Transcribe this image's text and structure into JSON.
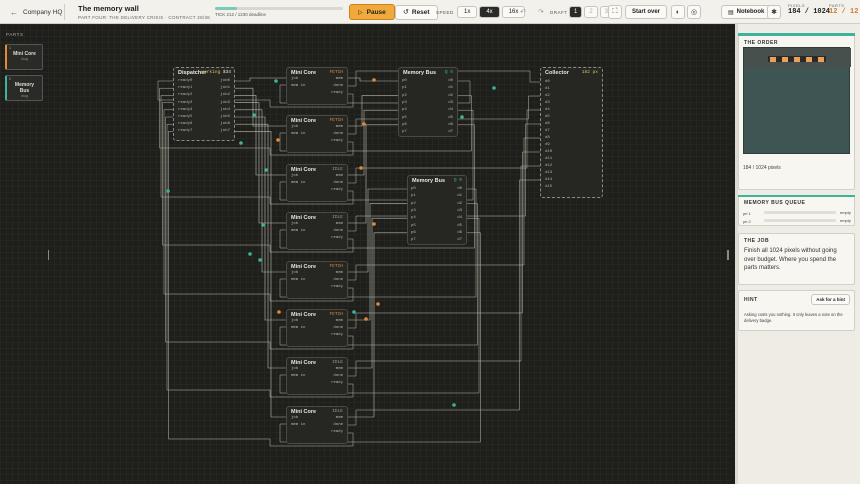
{
  "topbar": {
    "back_label": "Company HQ",
    "title": "The memory wall",
    "subtitle": "PART FOUR: THE DELIVERY CRISIS · CONTRACT 28/36",
    "tick_text": "TICK 212 / 1230 deadline",
    "tick_progress": 0.17,
    "pause_label": "Pause",
    "reset_label": "Reset",
    "speed_label": "SPEED",
    "speeds": [
      "1x",
      "4x",
      "16x"
    ],
    "draft_label": "DRAFT",
    "drafts": [
      "1",
      "2",
      "3"
    ],
    "start_over_label": "Start over",
    "notebook_label": "Notebook",
    "pixels_label": "PIXELS",
    "pixels_value": "184 / 1024",
    "parts_label": "PARTS",
    "parts_value": "12 / 12"
  },
  "parts_panel": {
    "title": "PARTS",
    "items": [
      {
        "count": "1",
        "name": "Mini Core",
        "action": "drag",
        "color": "#e08a3c"
      },
      {
        "count": "2",
        "name": "Memory Bus",
        "action": "drag",
        "color": "#3cb39a"
      }
    ]
  },
  "nodes": {
    "dispatcher": {
      "title": "Dispatcher",
      "status": "working",
      "count": "$34",
      "inputs": [
        "ready0",
        "ready1",
        "ready2",
        "ready3",
        "ready4",
        "ready5",
        "ready6",
        "ready7"
      ],
      "outputs": [
        "job0",
        "job1",
        "job2",
        "job3",
        "job4",
        "job5",
        "job6",
        "job7"
      ]
    },
    "cores": [
      {
        "title": "Mini Core",
        "status": "FETCH"
      },
      {
        "title": "Mini Core",
        "status": "FETCH"
      },
      {
        "title": "Mini Core",
        "status": "IDLE"
      },
      {
        "title": "Mini Core",
        "status": "IDLE"
      },
      {
        "title": "Mini Core",
        "status": "FETCH"
      },
      {
        "title": "Mini Core",
        "status": "FETCH"
      },
      {
        "title": "Mini Core",
        "status": "IDLE"
      },
      {
        "title": "Mini Core",
        "status": "IDLE"
      }
    ],
    "core_ports": {
      "in": [
        "job",
        "mem in"
      ],
      "out": [
        "mem",
        "done",
        "ready"
      ]
    },
    "membus1": {
      "title": "Memory Bus",
      "status": "Q 0"
    },
    "membus2": {
      "title": "Memory Bus",
      "status": "Q 0"
    },
    "membus_ports": {
      "in": [
        "p0",
        "p1",
        "p2",
        "p3",
        "p4",
        "p5",
        "p6",
        "p7"
      ],
      "out": [
        "d0",
        "d1",
        "d2",
        "d3",
        "d4",
        "d5",
        "d6",
        "d7"
      ]
    },
    "collector": {
      "title": "Collector",
      "status": "182 px",
      "inputs": [
        "d0",
        "d1",
        "d2",
        "d3",
        "d4",
        "d5",
        "d6",
        "d7",
        "d8",
        "d9",
        "d10",
        "d11",
        "d12",
        "d13",
        "d14",
        "d15"
      ]
    }
  },
  "order": {
    "title": "THE ORDER",
    "pixels_text": "184 / 1024 pixels",
    "fill_fraction": 0.18
  },
  "queue": {
    "title": "MEMORY BUS QUEUE",
    "rows": [
      {
        "label": "pri 1",
        "fill": 0.0,
        "value": "empty"
      },
      {
        "label": "pri 2",
        "fill": 0.0,
        "value": "empty"
      }
    ]
  },
  "job": {
    "title": "THE JOB",
    "text": "Finish all 1024 pixels without going over budget. Where you spend the parts matters."
  },
  "hint": {
    "title": "HINT",
    "button": "Ask for a hint",
    "text": "Asking costs you nothing. It only leaves a note on the delivery badge."
  },
  "colors": {
    "accent": "#f2a93b",
    "teal": "#3cb39a",
    "orange": "#e08a3c",
    "yellow": "#d9c46a"
  }
}
